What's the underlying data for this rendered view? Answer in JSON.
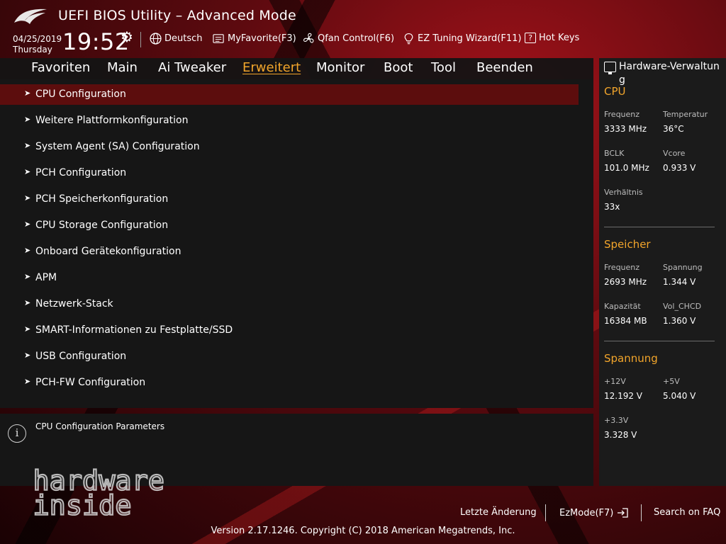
{
  "header": {
    "title": "UEFI BIOS Utility – Advanced Mode",
    "date": "04/25/2019",
    "weekday": "Thursday",
    "time": "19:52",
    "tools": [
      {
        "label": "Deutsch",
        "icon": "globe-icon"
      },
      {
        "label": "MyFavorite(F3)",
        "icon": "favorite-list-icon"
      },
      {
        "label": "Qfan Control(F6)",
        "icon": "fan-icon"
      },
      {
        "label": "EZ Tuning Wizard(F11)",
        "icon": "lightbulb-icon"
      },
      {
        "label": "Hot Keys",
        "icon": "question-icon"
      }
    ]
  },
  "nav": {
    "tabs": [
      "Favoriten",
      "Main",
      "Ai Tweaker",
      "Erweitert",
      "Monitor",
      "Boot",
      "Tool",
      "Beenden"
    ],
    "active": "Erweitert"
  },
  "menu": {
    "items": [
      "CPU Configuration",
      "Weitere Plattformkonfiguration",
      "System Agent (SA) Configuration",
      "PCH Configuration",
      "PCH Speicherkonfiguration",
      "CPU Storage Configuration",
      "Onboard Gerätekonfiguration",
      "APM",
      "Netzwerk-Stack",
      "SMART-Informationen zu Festplatte/SSD",
      "USB Configuration",
      "PCH-FW Configuration"
    ],
    "selected_index": 0
  },
  "help": {
    "text": "CPU Configuration Parameters",
    "watermark_line1": "hardware",
    "watermark_line2": "inside"
  },
  "hw_monitor": {
    "title": "Hardware-Verwaltung",
    "cpu": {
      "heading": "CPU",
      "frequency_label": "Frequenz",
      "frequency": "3333 MHz",
      "temperature_label": "Temperatur",
      "temperature": "36°C",
      "bclk_label": "BCLK",
      "bclk": "101.0 MHz",
      "vcore_label": "Vcore",
      "vcore": "0.933 V",
      "ratio_label": "Verhältnis",
      "ratio": "33x"
    },
    "memory": {
      "heading": "Speicher",
      "frequency_label": "Frequenz",
      "frequency": "2693 MHz",
      "voltage_label": "Spannung",
      "voltage": "1.344 V",
      "capacity_label": "Kapazität",
      "capacity": "16384 MB",
      "vol_chcd_label": "Vol_CHCD",
      "vol_chcd": "1.360 V"
    },
    "voltage": {
      "heading": "Spannung",
      "v12_label": "+12V",
      "v12": "12.192 V",
      "v5_label": "+5V",
      "v5": "5.040 V",
      "v33_label": "+3.3V",
      "v33": "3.328 V"
    }
  },
  "footer": {
    "last_change": "Letzte Änderung",
    "ezmode": "EzMode(F7)",
    "search_faq": "Search on FAQ",
    "copyright": "Version 2.17.1246. Copyright (C) 2018 American Megatrends, Inc."
  },
  "colors": {
    "accent": "#f2a52b",
    "selected_row": "#5c0d0d",
    "panel": "#161616"
  }
}
